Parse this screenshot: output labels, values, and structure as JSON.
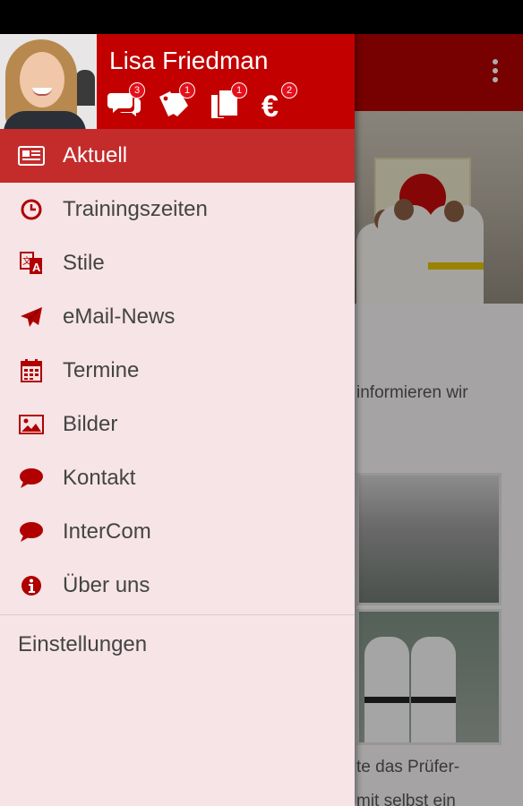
{
  "user": {
    "name": "Lisa Friedman"
  },
  "header_icons": [
    {
      "icon": "chat-bubbles-icon",
      "badge": "3"
    },
    {
      "icon": "tags-icon",
      "badge": "1"
    },
    {
      "icon": "documents-icon",
      "badge": "1"
    },
    {
      "icon": "euro-icon",
      "badge": "2"
    }
  ],
  "menu": [
    {
      "label": "Aktuell",
      "icon": "newspaper-icon",
      "active": true
    },
    {
      "label": "Trainingszeiten",
      "icon": "clock-icon"
    },
    {
      "label": "Stile",
      "icon": "translate-icon"
    },
    {
      "label": "eMail-News",
      "icon": "paper-plane-icon"
    },
    {
      "label": "Termine",
      "icon": "calendar-icon"
    },
    {
      "label": "Bilder",
      "icon": "image-icon"
    },
    {
      "label": "Kontakt",
      "icon": "chat-icon"
    },
    {
      "label": "InterCom",
      "icon": "chat-icon"
    },
    {
      "label": "Über uns",
      "icon": "info-icon"
    }
  ],
  "settings": {
    "label": "Einstellungen"
  },
  "background": {
    "text_1": "informieren wir",
    "text_2": "te das Prüfer-",
    "text_3": "mit selbst ein"
  },
  "colors": {
    "primary": "#c20000",
    "active_item": "#c42c2c",
    "drawer_bg": "#f6e4e6",
    "icon_red": "#b00000"
  }
}
